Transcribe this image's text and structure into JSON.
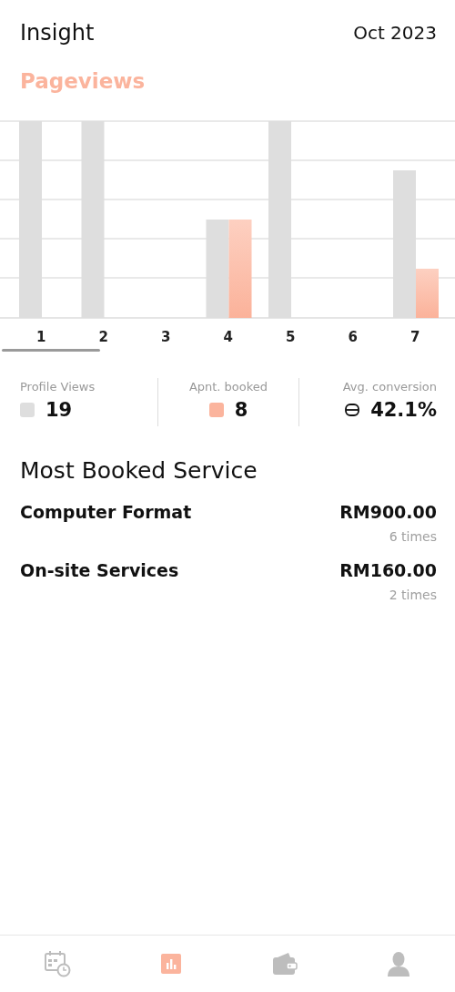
{
  "header": {
    "title": "Insight",
    "period": "Oct 2023"
  },
  "chart": {
    "title": "Pageviews",
    "x_labels": [
      "1",
      "2",
      "3",
      "4",
      "5",
      "6",
      "7"
    ]
  },
  "stats": [
    {
      "kind": "swatch",
      "label": "Profile Views",
      "value": "19",
      "color": "#dedede"
    },
    {
      "kind": "swatch",
      "label": "Apnt. booked",
      "value": "8",
      "color": "#fbb49d"
    },
    {
      "kind": "ratio",
      "label": "Avg. conversion",
      "value": "42.1%"
    }
  ],
  "services": {
    "title": "Most Booked Service",
    "items": [
      {
        "name": "Computer Format",
        "amount": "RM900.00",
        "count": "6 times"
      },
      {
        "name": "On-site Services",
        "amount": "RM160.00",
        "count": "2 times"
      }
    ]
  },
  "nav": [
    {
      "selected": false
    },
    {
      "selected": true
    },
    {
      "selected": false
    },
    {
      "selected": false
    }
  ]
}
